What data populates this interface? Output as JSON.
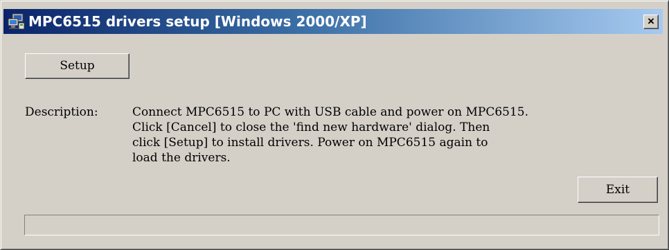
{
  "window": {
    "title": "MPC6515 drivers setup [Windows 2000/XP]",
    "title_bar_color": "#0a246a",
    "close_symbol": "×"
  },
  "buttons": {
    "setup_label": "Setup",
    "exit_label": "Exit"
  },
  "description": {
    "label": "Description:",
    "lines": [
      "Connect MPC6515 to PC with USB cable and power on MPC6515.",
      "Click [Cancel] to close the 'find new hardware' dialog. Then",
      "click [Setup] to install drivers. Power on MPC6515 again to",
      "load the drivers."
    ]
  },
  "progress": {
    "value": 0
  },
  "icons": {
    "app": "computer-monitor-icon",
    "close": "close-icon"
  }
}
